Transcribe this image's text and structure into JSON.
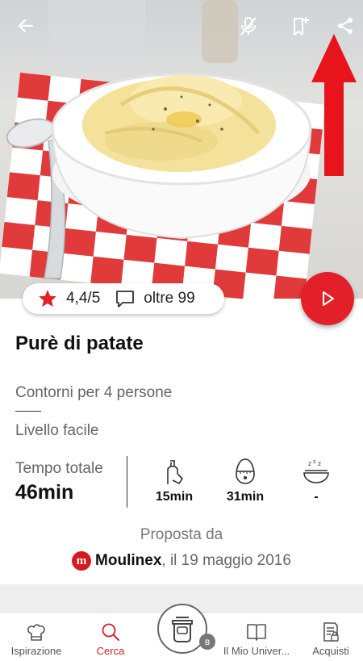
{
  "recipe": {
    "title": "Purè di patate",
    "category": "Contorni per 4 persone",
    "level": "Livello facile",
    "rating": "4,4/5",
    "comments": "oltre 99",
    "total_time_label": "Tempo totale",
    "total_time": "46min",
    "prep_time": "15min",
    "cook_time": "31min",
    "rest_time": "-",
    "proposed_label": "Proposta da",
    "proposer_brand": "Moulinex",
    "proposer_date": ", il 19 maggio 2016",
    "brand_logo_letter": "m"
  },
  "topbar": {
    "icons": [
      "back-arrow-icon",
      "mic-off-icon",
      "bookmark-add-icon",
      "share-icon"
    ]
  },
  "nav": {
    "items": [
      {
        "label": "Ispirazione",
        "icon": "chef-hat-icon"
      },
      {
        "label": "Cerca",
        "icon": "search-icon",
        "active": true
      },
      {
        "label": "",
        "icon": "cooking-device-icon"
      },
      {
        "label": "Il Mio Univer...",
        "icon": "book-icon"
      },
      {
        "label": "Acquisti",
        "icon": "shopping-list-icon"
      }
    ],
    "bluetooth_badge": "ʙ"
  },
  "colors": {
    "accent": "#e3202a",
    "active_nav": "#d42128",
    "annotation_arrow": "#e8141c"
  }
}
